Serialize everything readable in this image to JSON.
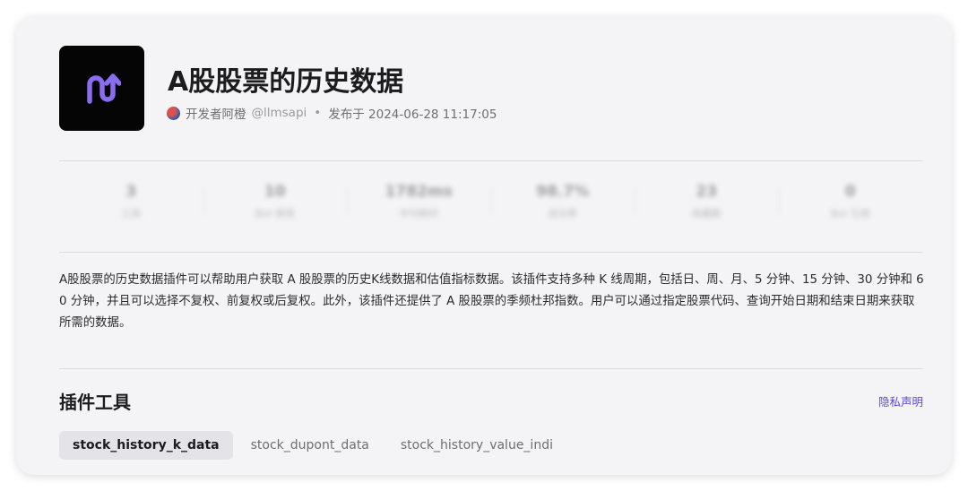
{
  "plugin": {
    "title": "A股股票的历史数据",
    "developer_label": "开发者阿橙",
    "handle": "@llmsapi",
    "separator": "•",
    "published": "发布于 2024-06-28 11:17:05",
    "logo_color": "#8a6cf0"
  },
  "stats": [
    {
      "value": "3",
      "label": "工具"
    },
    {
      "value": "10",
      "label": "Bot 使用"
    },
    {
      "value": "1782ms",
      "label": "平均耗时"
    },
    {
      "value": "98.7%",
      "label": "成功率"
    },
    {
      "value": "23",
      "label": "收藏数"
    },
    {
      "value": "0",
      "label": "Bot 引用"
    }
  ],
  "description": "A股股票的历史数据插件可以帮助用户获取 A 股股票的历史K线数据和估值指标数据。该插件支持多种 K 线周期，包括日、周、月、5 分钟、15 分钟、30 分钟和 60 分钟，并且可以选择不复权、前复权或后复权。此外，该插件还提供了 A 股股票的季频杜邦指数。用户可以通过指定股票代码、查询开始日期和结束日期来获取所需的数据。",
  "tools_section": {
    "title": "插件工具",
    "privacy_link": "隐私声明",
    "tabs": [
      {
        "label": "stock_history_k_data",
        "active": true
      },
      {
        "label": "stock_dupont_data",
        "active": false
      },
      {
        "label": "stock_history_value_indi",
        "active": false
      }
    ]
  }
}
